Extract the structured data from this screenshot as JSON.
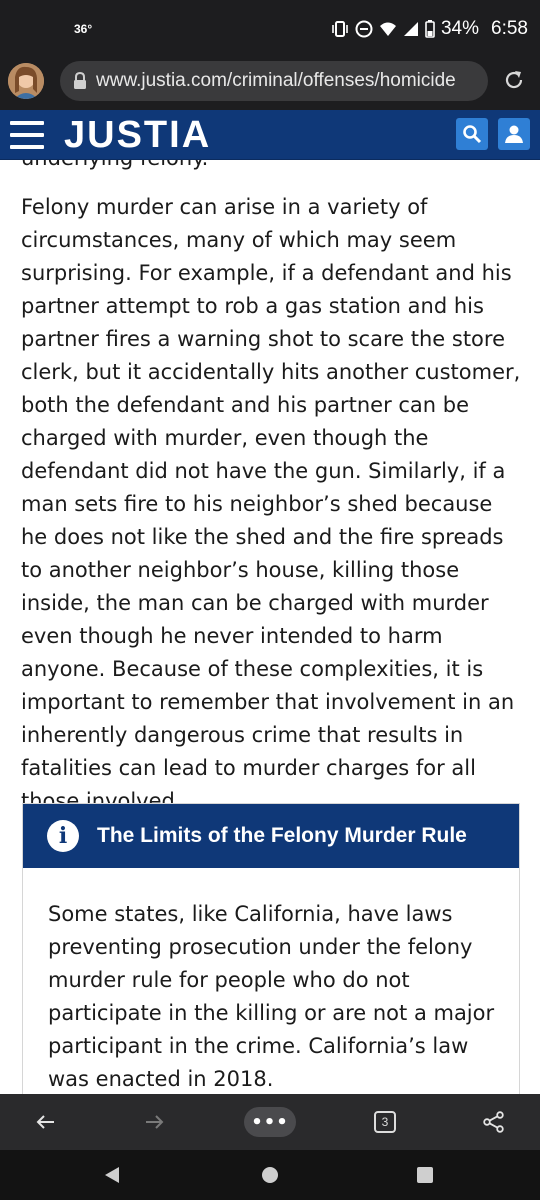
{
  "status": {
    "temperature": "36°",
    "battery": "34%",
    "time": "6:58"
  },
  "browser": {
    "url": "www.justia.com/criminal/offenses/homicide",
    "open_tabs": "3",
    "menu_label": "•••"
  },
  "site": {
    "logo": "JUSTIA"
  },
  "article": {
    "cut_off_line": "underlying felony.",
    "paragraph": "Felony murder can arise in a variety of circumstances, many of which may seem surprising. For example, if a defendant and his partner attempt to rob a gas station and his partner fires a warning shot to scare the store clerk, but it accidentally hits another customer, both the defendant and his partner can be charged with murder, even though the defendant did not have the gun. Similarly, if a man sets fire to his neighbor’s shed because he does not like the shed and the fire spreads to another neighbor’s house, killing those inside, the man can be charged with murder even though he never intended to harm anyone. Because of these complexities, it is important to remember that involvement in an inherently dangerous crime that results in fatalities can lead to murder charges for all those involved.",
    "callout": {
      "icon": "info-icon",
      "icon_glyph": "i",
      "title": "The Limits of the Felony Murder Rule",
      "body": "Some states, like California, have laws preventing prosecution under the felony murder rule for people who do not participate in the killing or are not a major participant in the crime. California’s law was enacted in 2018."
    }
  },
  "colors": {
    "brand_navy": "#0f3878",
    "brand_button_blue": "#2f7fd5",
    "system_bar": "#1d1d1f"
  }
}
